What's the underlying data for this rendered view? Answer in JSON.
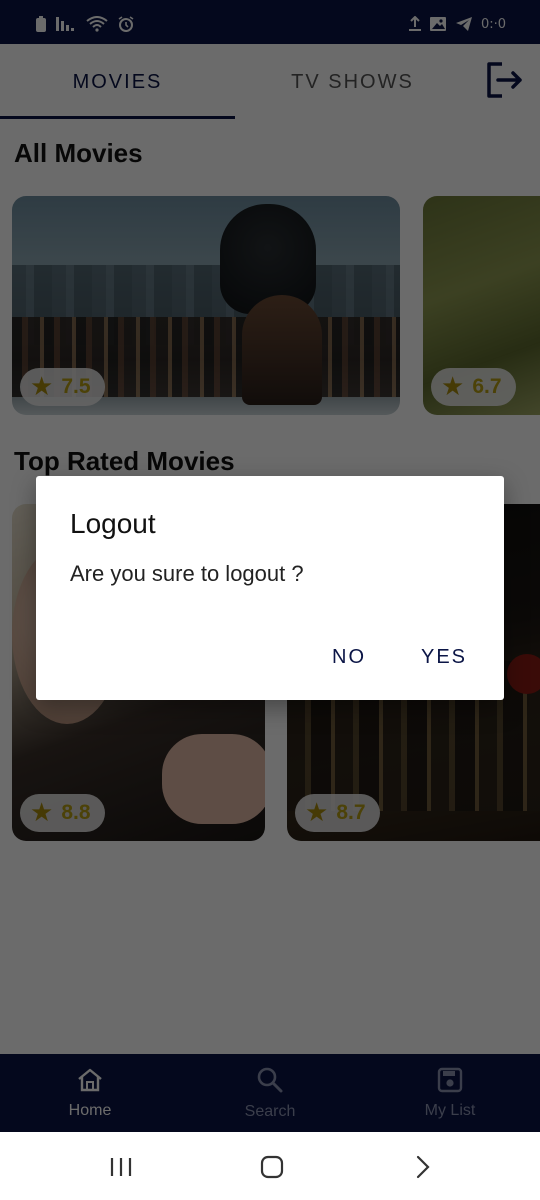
{
  "status_bar": {
    "time": "0:·0",
    "icons": [
      "battery-icon",
      "signal-icon",
      "wifi-icon",
      "alarm-icon",
      "upload-icon",
      "image-icon",
      "telegram-icon"
    ]
  },
  "tabs": [
    {
      "label": "MOVIES",
      "active": true
    },
    {
      "label": "TV SHOWS",
      "active": false
    }
  ],
  "header": {
    "logout_icon": "logout-icon"
  },
  "sections": {
    "all_movies": {
      "title": "All Movies",
      "cards": [
        {
          "rating": "7.5"
        },
        {
          "rating": "6.7"
        }
      ]
    },
    "top_rated": {
      "title": "Top Rated Movies",
      "cards": [
        {
          "rating": "8.8"
        },
        {
          "rating": "8.7"
        }
      ]
    }
  },
  "dialog": {
    "title": "Logout",
    "message": "Are you sure to logout ?",
    "no_label": "NO",
    "yes_label": "YES"
  },
  "bottom_nav": [
    {
      "label": "Home",
      "icon": "home-icon",
      "active": true
    },
    {
      "label": "Search",
      "icon": "search-icon",
      "active": false
    },
    {
      "label": "My List",
      "icon": "save-icon",
      "active": false
    }
  ],
  "colors": {
    "primary": "#0b1546",
    "rating_text": "#b59d15",
    "inactive_nav": "#8c93b3"
  }
}
